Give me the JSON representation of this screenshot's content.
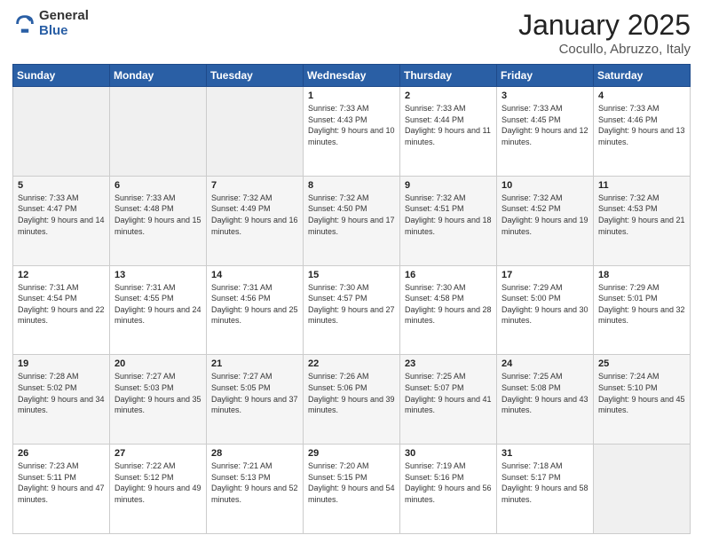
{
  "logo": {
    "general": "General",
    "blue": "Blue"
  },
  "header": {
    "month": "January 2025",
    "location": "Cocullo, Abruzzo, Italy"
  },
  "weekdays": [
    "Sunday",
    "Monday",
    "Tuesday",
    "Wednesday",
    "Thursday",
    "Friday",
    "Saturday"
  ],
  "weeks": [
    [
      {
        "day": "",
        "sunrise": "",
        "sunset": "",
        "daylight": ""
      },
      {
        "day": "",
        "sunrise": "",
        "sunset": "",
        "daylight": ""
      },
      {
        "day": "",
        "sunrise": "",
        "sunset": "",
        "daylight": ""
      },
      {
        "day": "1",
        "sunrise": "Sunrise: 7:33 AM",
        "sunset": "Sunset: 4:43 PM",
        "daylight": "Daylight: 9 hours and 10 minutes."
      },
      {
        "day": "2",
        "sunrise": "Sunrise: 7:33 AM",
        "sunset": "Sunset: 4:44 PM",
        "daylight": "Daylight: 9 hours and 11 minutes."
      },
      {
        "day": "3",
        "sunrise": "Sunrise: 7:33 AM",
        "sunset": "Sunset: 4:45 PM",
        "daylight": "Daylight: 9 hours and 12 minutes."
      },
      {
        "day": "4",
        "sunrise": "Sunrise: 7:33 AM",
        "sunset": "Sunset: 4:46 PM",
        "daylight": "Daylight: 9 hours and 13 minutes."
      }
    ],
    [
      {
        "day": "5",
        "sunrise": "Sunrise: 7:33 AM",
        "sunset": "Sunset: 4:47 PM",
        "daylight": "Daylight: 9 hours and 14 minutes."
      },
      {
        "day": "6",
        "sunrise": "Sunrise: 7:33 AM",
        "sunset": "Sunset: 4:48 PM",
        "daylight": "Daylight: 9 hours and 15 minutes."
      },
      {
        "day": "7",
        "sunrise": "Sunrise: 7:32 AM",
        "sunset": "Sunset: 4:49 PM",
        "daylight": "Daylight: 9 hours and 16 minutes."
      },
      {
        "day": "8",
        "sunrise": "Sunrise: 7:32 AM",
        "sunset": "Sunset: 4:50 PM",
        "daylight": "Daylight: 9 hours and 17 minutes."
      },
      {
        "day": "9",
        "sunrise": "Sunrise: 7:32 AM",
        "sunset": "Sunset: 4:51 PM",
        "daylight": "Daylight: 9 hours and 18 minutes."
      },
      {
        "day": "10",
        "sunrise": "Sunrise: 7:32 AM",
        "sunset": "Sunset: 4:52 PM",
        "daylight": "Daylight: 9 hours and 19 minutes."
      },
      {
        "day": "11",
        "sunrise": "Sunrise: 7:32 AM",
        "sunset": "Sunset: 4:53 PM",
        "daylight": "Daylight: 9 hours and 21 minutes."
      }
    ],
    [
      {
        "day": "12",
        "sunrise": "Sunrise: 7:31 AM",
        "sunset": "Sunset: 4:54 PM",
        "daylight": "Daylight: 9 hours and 22 minutes."
      },
      {
        "day": "13",
        "sunrise": "Sunrise: 7:31 AM",
        "sunset": "Sunset: 4:55 PM",
        "daylight": "Daylight: 9 hours and 24 minutes."
      },
      {
        "day": "14",
        "sunrise": "Sunrise: 7:31 AM",
        "sunset": "Sunset: 4:56 PM",
        "daylight": "Daylight: 9 hours and 25 minutes."
      },
      {
        "day": "15",
        "sunrise": "Sunrise: 7:30 AM",
        "sunset": "Sunset: 4:57 PM",
        "daylight": "Daylight: 9 hours and 27 minutes."
      },
      {
        "day": "16",
        "sunrise": "Sunrise: 7:30 AM",
        "sunset": "Sunset: 4:58 PM",
        "daylight": "Daylight: 9 hours and 28 minutes."
      },
      {
        "day": "17",
        "sunrise": "Sunrise: 7:29 AM",
        "sunset": "Sunset: 5:00 PM",
        "daylight": "Daylight: 9 hours and 30 minutes."
      },
      {
        "day": "18",
        "sunrise": "Sunrise: 7:29 AM",
        "sunset": "Sunset: 5:01 PM",
        "daylight": "Daylight: 9 hours and 32 minutes."
      }
    ],
    [
      {
        "day": "19",
        "sunrise": "Sunrise: 7:28 AM",
        "sunset": "Sunset: 5:02 PM",
        "daylight": "Daylight: 9 hours and 34 minutes."
      },
      {
        "day": "20",
        "sunrise": "Sunrise: 7:27 AM",
        "sunset": "Sunset: 5:03 PM",
        "daylight": "Daylight: 9 hours and 35 minutes."
      },
      {
        "day": "21",
        "sunrise": "Sunrise: 7:27 AM",
        "sunset": "Sunset: 5:05 PM",
        "daylight": "Daylight: 9 hours and 37 minutes."
      },
      {
        "day": "22",
        "sunrise": "Sunrise: 7:26 AM",
        "sunset": "Sunset: 5:06 PM",
        "daylight": "Daylight: 9 hours and 39 minutes."
      },
      {
        "day": "23",
        "sunrise": "Sunrise: 7:25 AM",
        "sunset": "Sunset: 5:07 PM",
        "daylight": "Daylight: 9 hours and 41 minutes."
      },
      {
        "day": "24",
        "sunrise": "Sunrise: 7:25 AM",
        "sunset": "Sunset: 5:08 PM",
        "daylight": "Daylight: 9 hours and 43 minutes."
      },
      {
        "day": "25",
        "sunrise": "Sunrise: 7:24 AM",
        "sunset": "Sunset: 5:10 PM",
        "daylight": "Daylight: 9 hours and 45 minutes."
      }
    ],
    [
      {
        "day": "26",
        "sunrise": "Sunrise: 7:23 AM",
        "sunset": "Sunset: 5:11 PM",
        "daylight": "Daylight: 9 hours and 47 minutes."
      },
      {
        "day": "27",
        "sunrise": "Sunrise: 7:22 AM",
        "sunset": "Sunset: 5:12 PM",
        "daylight": "Daylight: 9 hours and 49 minutes."
      },
      {
        "day": "28",
        "sunrise": "Sunrise: 7:21 AM",
        "sunset": "Sunset: 5:13 PM",
        "daylight": "Daylight: 9 hours and 52 minutes."
      },
      {
        "day": "29",
        "sunrise": "Sunrise: 7:20 AM",
        "sunset": "Sunset: 5:15 PM",
        "daylight": "Daylight: 9 hours and 54 minutes."
      },
      {
        "day": "30",
        "sunrise": "Sunrise: 7:19 AM",
        "sunset": "Sunset: 5:16 PM",
        "daylight": "Daylight: 9 hours and 56 minutes."
      },
      {
        "day": "31",
        "sunrise": "Sunrise: 7:18 AM",
        "sunset": "Sunset: 5:17 PM",
        "daylight": "Daylight: 9 hours and 58 minutes."
      },
      {
        "day": "",
        "sunrise": "",
        "sunset": "",
        "daylight": ""
      }
    ]
  ]
}
